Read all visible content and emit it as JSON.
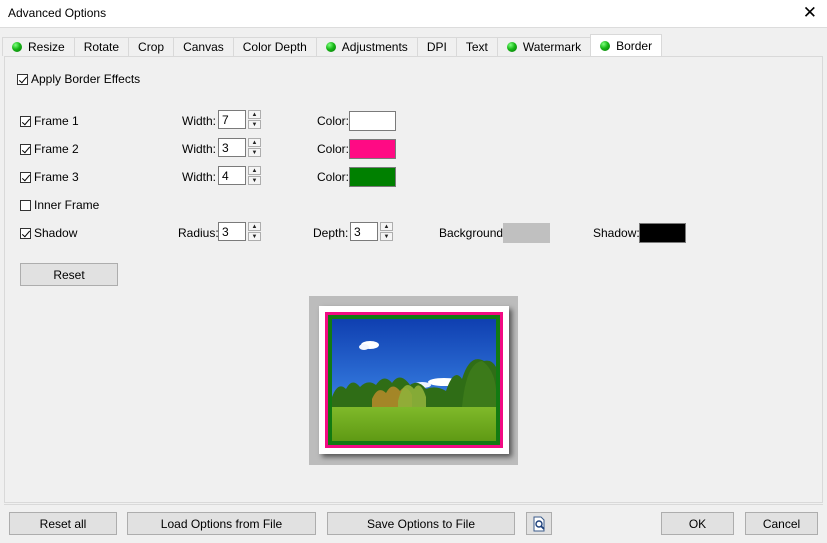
{
  "window": {
    "title": "Advanced Options",
    "close_glyph": "✕"
  },
  "tabs": [
    {
      "label": "Resize",
      "icon": "green-dot-icon",
      "active": false
    },
    {
      "label": "Rotate",
      "icon": "",
      "active": false
    },
    {
      "label": "Crop",
      "icon": "",
      "active": false
    },
    {
      "label": "Canvas",
      "icon": "",
      "active": false
    },
    {
      "label": "Color Depth",
      "icon": "",
      "active": false
    },
    {
      "label": "Adjustments",
      "icon": "green-dot-icon",
      "active": false
    },
    {
      "label": "DPI",
      "icon": "",
      "active": false
    },
    {
      "label": "Text",
      "icon": "",
      "active": false
    },
    {
      "label": "Watermark",
      "icon": "green-dot-icon",
      "active": false
    },
    {
      "label": "Border",
      "icon": "green-dot-icon",
      "active": true
    }
  ],
  "border": {
    "apply": {
      "label": "Apply Border Effects",
      "checked": true
    },
    "frames": [
      {
        "label": "Frame 1",
        "checked": true,
        "width_label": "Width:",
        "width": "7",
        "color_label": "Color:",
        "color": "#ffffff"
      },
      {
        "label": "Frame 2",
        "checked": true,
        "width_label": "Width:",
        "width": "3",
        "color_label": "Color:",
        "color": "#ff0a84"
      },
      {
        "label": "Frame 3",
        "checked": true,
        "width_label": "Width:",
        "width": "4",
        "color_label": "Color:",
        "color": "#008000"
      }
    ],
    "inner_frame": {
      "label": "Inner Frame",
      "checked": false
    },
    "shadow": {
      "label": "Shadow",
      "checked": true,
      "radius_label": "Radius:",
      "radius": "3",
      "depth_label": "Depth:",
      "depth": "3",
      "background_label": "Background:",
      "background_color": "#c0c0c0",
      "shadow_label": "Shadow:",
      "shadow_color": "#000000"
    },
    "reset_label": "Reset"
  },
  "footer": {
    "reset_all": "Reset all",
    "load": "Load Options from File",
    "save": "Save Options to File",
    "preview_icon": "magnifier-page-icon",
    "ok": "OK",
    "cancel": "Cancel"
  }
}
